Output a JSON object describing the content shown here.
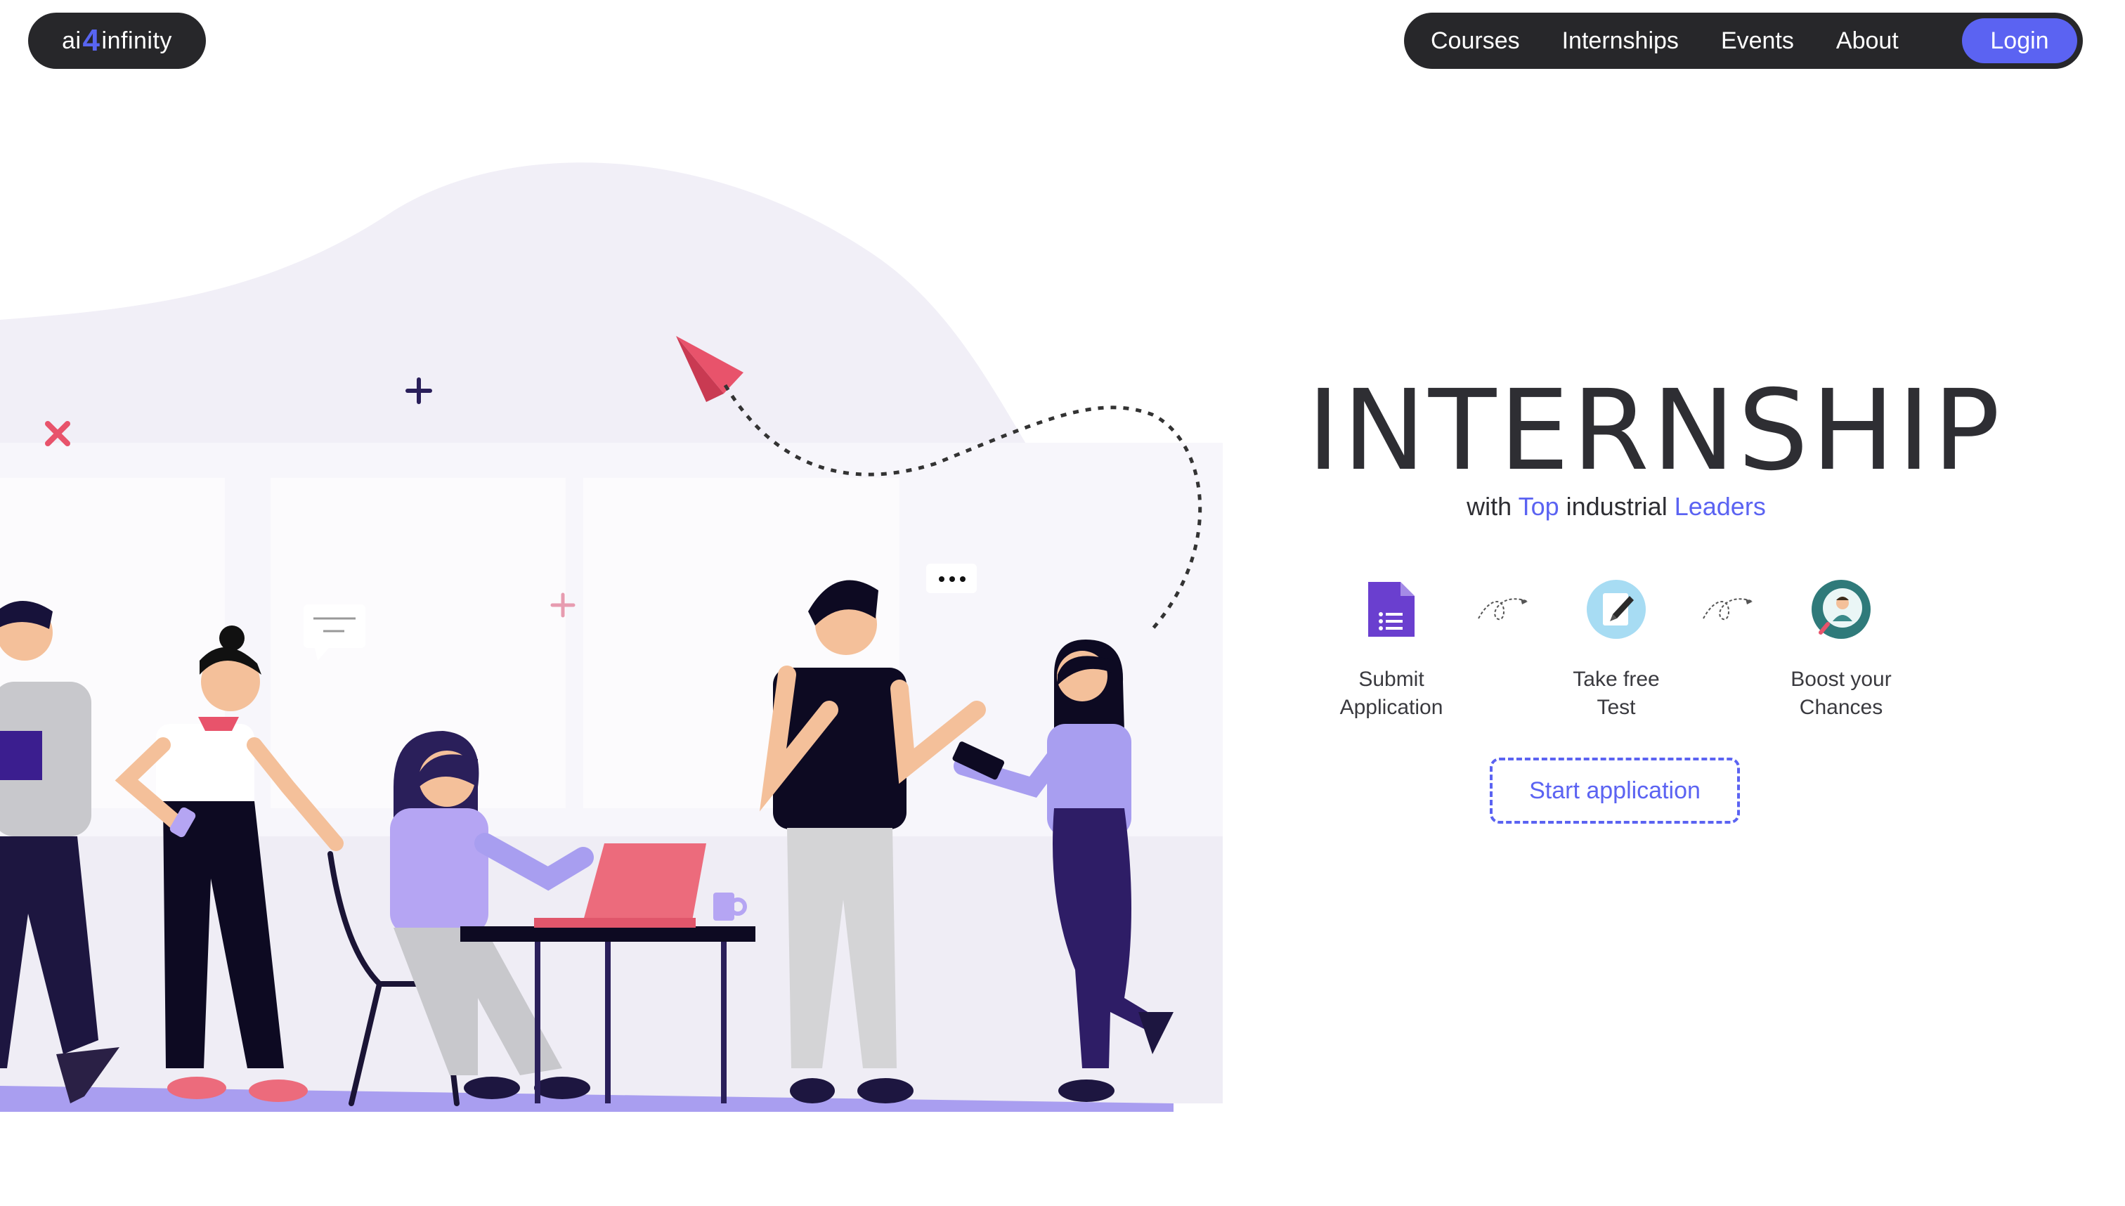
{
  "logo": {
    "prefix": "ai",
    "number": "4",
    "suffix": "infinity"
  },
  "nav": {
    "items": [
      {
        "label": "Courses"
      },
      {
        "label": "Internships"
      },
      {
        "label": "Events"
      },
      {
        "label": "About"
      }
    ],
    "login_label": "Login"
  },
  "hero": {
    "title": "INTERNSHIP",
    "subtitle": {
      "part1": "with",
      "accent1": "Top",
      "part2": "industrial",
      "accent2": "Leaders"
    },
    "steps": [
      {
        "line1": "Submit",
        "line2": "Application",
        "icon": "form-document-icon"
      },
      {
        "line1": "Take free",
        "line2": "Test",
        "icon": "test-paper-icon"
      },
      {
        "line1": "Boost your",
        "line2": "Chances",
        "icon": "person-search-icon"
      }
    ],
    "cta_label": "Start application"
  },
  "colors": {
    "accent": "#5b63f2",
    "dark": "#27272a",
    "blob": "#f1eff7",
    "purple": "#a89ef0",
    "pink": "#e8536b"
  }
}
